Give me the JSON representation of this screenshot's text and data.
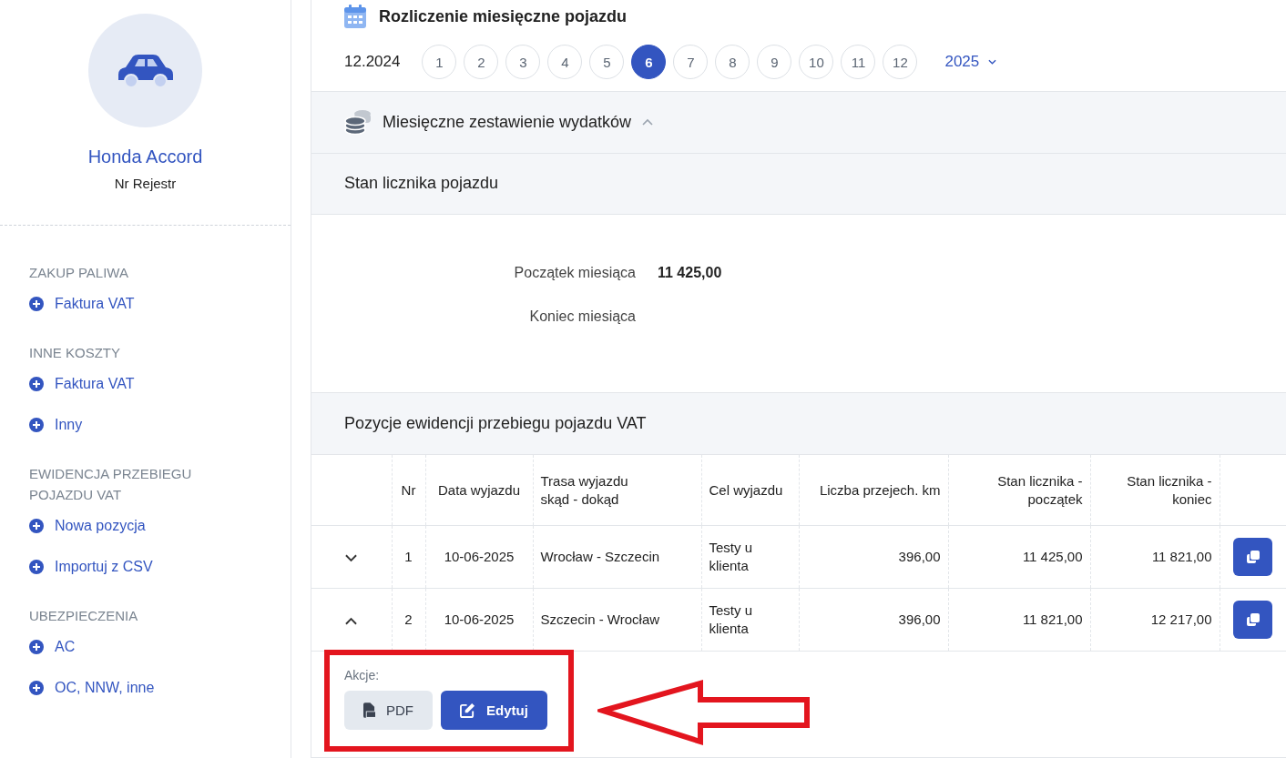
{
  "sidebar": {
    "vehicle": {
      "name": "Honda Accord",
      "plate": "Nr Rejestr"
    },
    "groups": [
      {
        "title": "ZAKUP PALIWA",
        "items": [
          "Faktura VAT"
        ]
      },
      {
        "title": "INNE KOSZTY",
        "items": [
          "Faktura VAT",
          "Inny"
        ]
      },
      {
        "title": "EWIDENCJA PRZEBIEGU POJAZDU VAT",
        "items": [
          "Nowa pozycja",
          "Importuj z CSV"
        ]
      },
      {
        "title": "UBEZPIECZENIA",
        "items": [
          "AC",
          "OC, NNW, inne"
        ]
      }
    ]
  },
  "header": {
    "title": "Rozliczenie miesięczne pojazdu",
    "previous": "12.2024",
    "months": [
      {
        "label": "1",
        "selected": false
      },
      {
        "label": "2",
        "selected": false
      },
      {
        "label": "3",
        "selected": false
      },
      {
        "label": "4",
        "selected": false
      },
      {
        "label": "5",
        "selected": false
      },
      {
        "label": "6",
        "selected": true
      },
      {
        "label": "7",
        "selected": false
      },
      {
        "label": "8",
        "selected": false
      },
      {
        "label": "9",
        "selected": false
      },
      {
        "label": "10",
        "selected": false
      },
      {
        "label": "11",
        "selected": false
      },
      {
        "label": "12",
        "selected": false
      }
    ],
    "year": "2025"
  },
  "summary": {
    "title": "Miesięczne zestawienie wydatków",
    "expanded": true
  },
  "odometer": {
    "title": "Stan licznika pojazdu",
    "fields": [
      {
        "label": "Początek miesiąca",
        "value": "11 425,00"
      },
      {
        "label": "Koniec miesiąca"
      }
    ]
  },
  "trips": {
    "title": "Pozycje ewidencji przebiegu pojazdu VAT",
    "columns": [
      "Nr",
      "Data wyjazdu",
      "Trasa wyjazdu\nskąd - dokąd",
      "Cel wyjazdu",
      "Liczba przejech. km",
      "Stan licznika -\npoczątek",
      "Stan licznika -\nkoniec"
    ],
    "rows": [
      {
        "expanded": false,
        "cells": [
          "1",
          "10-06-2025",
          "Wrocław - Szczecin",
          "Testy u\nklienta",
          "396,00",
          "11 425,00",
          "11 821,00"
        ]
      },
      {
        "expanded": true,
        "cells": [
          "2",
          "10-06-2025",
          "Szczecin - Wrocław",
          "Testy u\nklienta",
          "396,00",
          "11 821,00",
          "12 217,00"
        ]
      }
    ],
    "actions": {
      "label": "Akcje:",
      "buttons": [
        {
          "kind": "pdf",
          "label": "PDF"
        },
        {
          "kind": "edit",
          "label": "Edytuj"
        }
      ]
    }
  }
}
